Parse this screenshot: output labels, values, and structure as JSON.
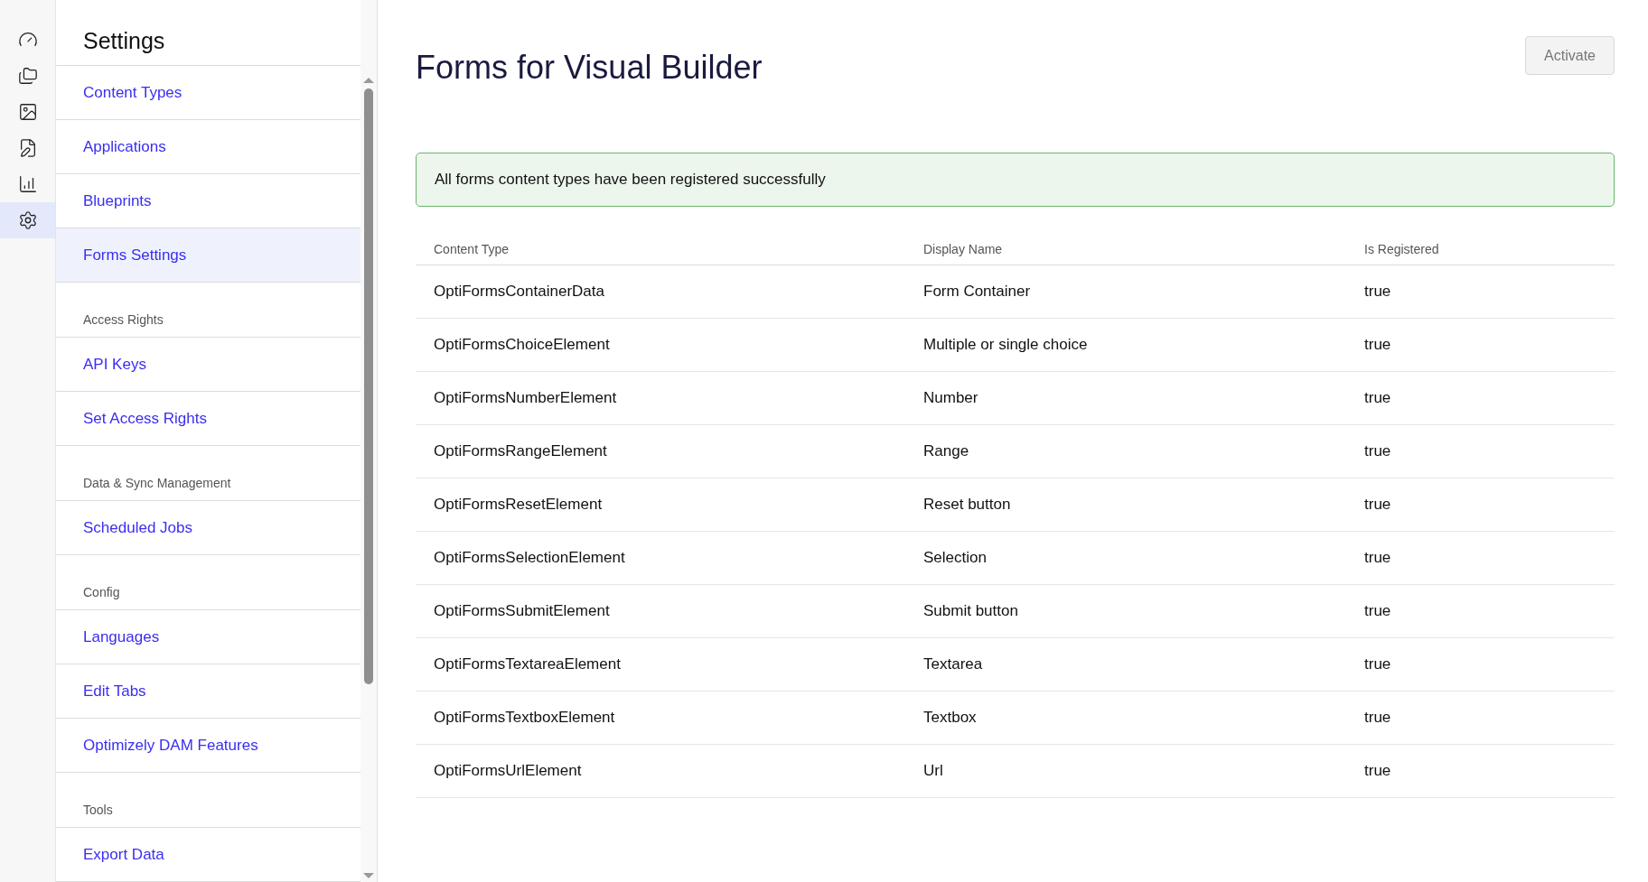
{
  "rail": {
    "items": [
      {
        "kind": "gauge",
        "selected": false
      },
      {
        "kind": "folders",
        "selected": false
      },
      {
        "kind": "image",
        "selected": false
      },
      {
        "kind": "edit",
        "selected": false
      },
      {
        "kind": "chart",
        "selected": false
      },
      {
        "kind": "gear",
        "selected": true
      }
    ]
  },
  "sidebar": {
    "title": "Settings",
    "sections": [
      {
        "items": [
          {
            "label": "Content Types",
            "selected": false
          },
          {
            "label": "Applications",
            "selected": false
          },
          {
            "label": "Blueprints",
            "selected": false
          },
          {
            "label": "Forms Settings",
            "selected": true
          }
        ]
      },
      {
        "heading": "Access Rights",
        "items": [
          {
            "label": "API Keys",
            "selected": false
          },
          {
            "label": "Set Access Rights",
            "selected": false
          }
        ]
      },
      {
        "heading": "Data & Sync Management",
        "items": [
          {
            "label": "Scheduled Jobs",
            "selected": false
          }
        ]
      },
      {
        "heading": "Config",
        "items": [
          {
            "label": "Languages",
            "selected": false
          },
          {
            "label": "Edit Tabs",
            "selected": false
          },
          {
            "label": "Optimizely DAM Features",
            "selected": false
          }
        ]
      },
      {
        "heading": "Tools",
        "items": [
          {
            "label": "Export Data",
            "selected": false
          }
        ]
      }
    ]
  },
  "main": {
    "title": "Forms for Visual Builder",
    "button": {
      "label": "Activate",
      "disabled": true
    },
    "alert": "All forms content types have been registered successfully",
    "table": {
      "columns": [
        "Content Type",
        "Display Name",
        "Is Registered"
      ],
      "rows": [
        [
          "OptiFormsContainerData",
          "Form Container",
          "true"
        ],
        [
          "OptiFormsChoiceElement",
          "Multiple or single choice",
          "true"
        ],
        [
          "OptiFormsNumberElement",
          "Number",
          "true"
        ],
        [
          "OptiFormsRangeElement",
          "Range",
          "true"
        ],
        [
          "OptiFormsResetElement",
          "Reset button",
          "true"
        ],
        [
          "OptiFormsSelectionElement",
          "Selection",
          "true"
        ],
        [
          "OptiFormsSubmitElement",
          "Submit button",
          "true"
        ],
        [
          "OptiFormsTextareaElement",
          "Textarea",
          "true"
        ],
        [
          "OptiFormsTextboxElement",
          "Textbox",
          "true"
        ],
        [
          "OptiFormsUrlElement",
          "Url",
          "true"
        ]
      ]
    }
  }
}
